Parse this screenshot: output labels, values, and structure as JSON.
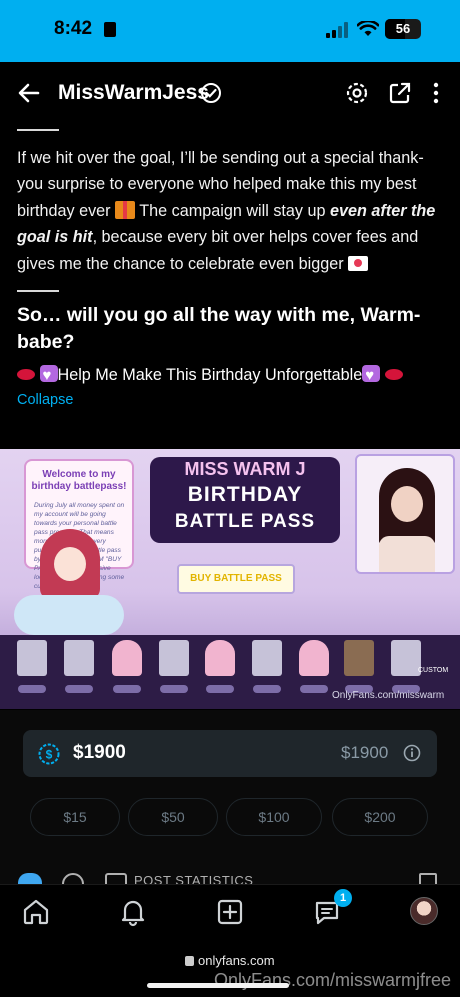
{
  "status_bar": {
    "time": "8:42",
    "battery": "56",
    "battery_level": 0.56,
    "bg_color": "#00aff0"
  },
  "header": {
    "title": "MissWarmJess",
    "icons": [
      "back-arrow-icon",
      "verified-badge-icon",
      "gear-icon",
      "share-icon",
      "more-vertical-icon"
    ]
  },
  "post": {
    "para1_a": "If we hit over the goal, I’ll be sending out a special thank-you surprise to everyone who helped make this my best birthday ever ",
    "para1_b": " The campaign will stay up ",
    "para1_em": "even after the goal is hit",
    "para1_c": ", because every bit over helps cover fees and gives me the chance to celebrate even bigger ",
    "heading": "So… will you go all the way with me, Warm-babe?",
    "cta": "Help Me Make This Birthday Unforgettable",
    "collapse": "Collapse",
    "link_color": "#00aff0"
  },
  "banner": {
    "card_title": "Welcome to my birthday battlepass!",
    "card_body": "During July all money spent on my account will be going towards your personal battle pass progress. That means more rewards with every purchase! Buy the battle pass by tipping 1900 and DM \"BUY PASS\" to unlock exclusive locked content, including some custom!",
    "title_line1": "MISS WARM J",
    "title_line2": "BIRTHDAY",
    "title_line3": "BATTLE PASS",
    "button": "BUY BATTLE PASS",
    "custom_label": "CUSTOM",
    "watermark": "OnlyFans.com/misswarm"
  },
  "tip": {
    "amount": "$1900",
    "amount_right": "$1900",
    "options": [
      "$15",
      "$50",
      "$100",
      "$200"
    ]
  },
  "post_stats": {
    "label": "POST STATISTICS"
  },
  "tabbar": {
    "items": [
      "home-icon",
      "bell-icon",
      "plus-square-icon",
      "messages-icon",
      "avatar"
    ],
    "messages_badge": "1"
  },
  "browser": {
    "url": "onlyfans.com",
    "watermark": "OnlyFans.com/misswarmjfree"
  }
}
